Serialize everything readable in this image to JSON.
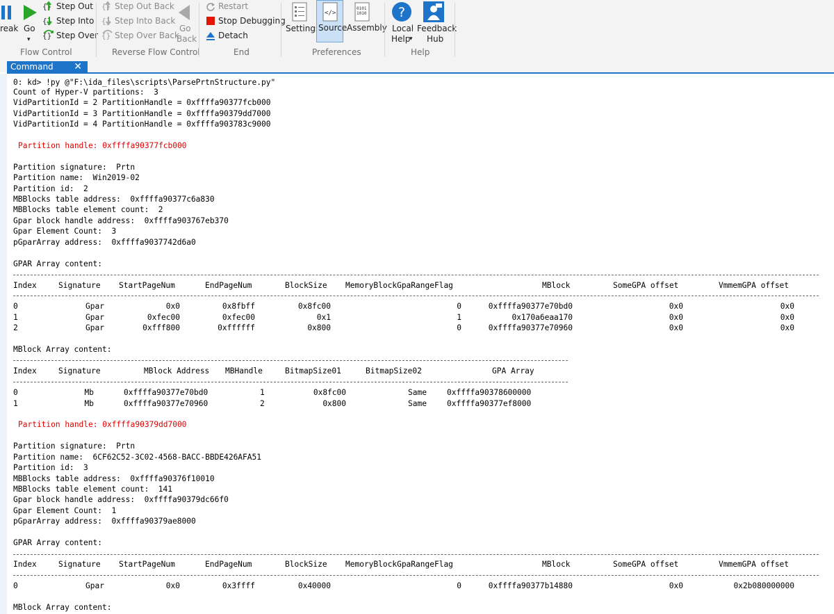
{
  "ribbon": {
    "break_label": "reak",
    "go_label": "Go",
    "step_out": "Step Out",
    "step_into": "Step Into",
    "step_over": "Step Over",
    "step_out_back": "Step Out Back",
    "step_into_back": "Step Into Back",
    "step_over_back": "Step Over Back",
    "go_back_line1": "Go",
    "go_back_line2": "Back",
    "restart": "Restart",
    "stop_debugging": "Stop Debugging",
    "detach": "Detach",
    "settings": "Settings",
    "source": "Source",
    "assembly": "Assembly",
    "local_help_line1": "Local",
    "local_help_line2": "Help",
    "feedback_line1": "Feedback",
    "feedback_line2": "Hub",
    "groups": {
      "flow_control": "Flow Control",
      "reverse_flow_control": "Reverse Flow Control",
      "end": "End",
      "preferences": "Preferences",
      "help": "Help"
    }
  },
  "tab": {
    "label": "Command",
    "close": "✕"
  },
  "colors": {
    "accent": "#1e74c8",
    "partition_handle": "#e00000",
    "stop_red": "#e51400"
  },
  "icons": [
    "break-icon",
    "go-icon",
    "step-out-icon",
    "step-into-icon",
    "step-over-icon",
    "step-out-back-icon",
    "step-into-back-icon",
    "step-over-back-icon",
    "go-back-icon",
    "restart-icon",
    "stop-icon",
    "detach-icon",
    "settings-icon",
    "source-icon",
    "assembly-icon",
    "help-icon",
    "feedback-icon"
  ],
  "output": {
    "header": [
      "0: kd> !py @\"F:\\ida_files\\scripts\\ParsePrtnStructure.py\"",
      "Count of Hyper-V partitions:  3",
      "VidPartitionId = 2 PartitionHandle = 0xffffa90377fcb000",
      "VidPartitionId = 3 PartitionHandle = 0xffffa90379dd7000",
      "VidPartitionId = 4 PartitionHandle = 0xffffa903783c9000"
    ],
    "partitions": [
      {
        "handle_line": "Partition handle: 0xffffa90377fcb000",
        "info": [
          "Partition signature:  Prtn",
          "Partition name:  Win2019-02",
          "Partition id:  2",
          "MBBlocks table address:  0xffffa90377c6a830",
          "MBBlocks table element count:  2",
          "Gpar block handle address:  0xffffa903767eb370",
          "Gpar Element Count:  3",
          "pGparArray address:  0xffffa9037742d6a0"
        ],
        "gpar_title": "GPAR Array content:",
        "gpar_rows": [
          [
            "0",
            "Gpar",
            "0x0",
            "0x8fbff",
            "0x8fc00",
            "0",
            "0xffffa90377e70bd0",
            "0x0",
            "0x0"
          ],
          [
            "1",
            "Gpar",
            "0xfec00",
            "0xfec00",
            "0x1",
            "1",
            "0x170a6eaa170",
            "0x0",
            "0x0"
          ],
          [
            "2",
            "Gpar",
            "0xfff800",
            "0xffffff",
            "0x800",
            "0",
            "0xffffa90377e70960",
            "0x0",
            "0x0"
          ]
        ],
        "mblock_title": "MBlock Array content:",
        "mblock_rows": [
          [
            "0",
            "Mb",
            "0xffffa90377e70bd0",
            "1",
            "0x8fc00",
            "Same",
            "0xffffa90378600000"
          ],
          [
            "1",
            "Mb",
            "0xffffa90377e70960",
            "2",
            "0x800",
            "Same",
            "0xffffa90377ef8000"
          ]
        ]
      },
      {
        "handle_line": "Partition handle: 0xffffa90379dd7000",
        "info": [
          "Partition signature:  Prtn",
          "Partition name:  6CF62C52-3C02-4568-BACC-BBDE426AFA51",
          "Partition id:  3",
          "MBBlocks table address:  0xffffa90376f10010",
          "MBBlocks table element count:  141",
          "Gpar block handle address:  0xffffa90379dc66f0",
          "Gpar Element Count:  1",
          "pGparArray address:  0xffffa90379ae8000"
        ],
        "gpar_title": "GPAR Array content:",
        "gpar_rows": [
          [
            "0",
            "Gpar",
            "0x0",
            "0x3ffff",
            "0x40000",
            "0",
            "0xffffa90377b14880",
            "0x0",
            "0x2b080000000"
          ]
        ],
        "mblock_title": "MBlock Array content:"
      }
    ],
    "gpar_headers": [
      "Index",
      "Signature",
      "StartPageNum",
      "EndPageNum",
      "BlockSize",
      "MemoryBlockGpaRangeFlag",
      "MBlock",
      "SomeGPA offset",
      "VmmemGPA offset"
    ],
    "mblock_headers": [
      "Index",
      "Signature",
      "MBlock Address",
      "MBHandle",
      "BitmapSize01",
      "BitmapSize02",
      "GPA Array"
    ]
  }
}
